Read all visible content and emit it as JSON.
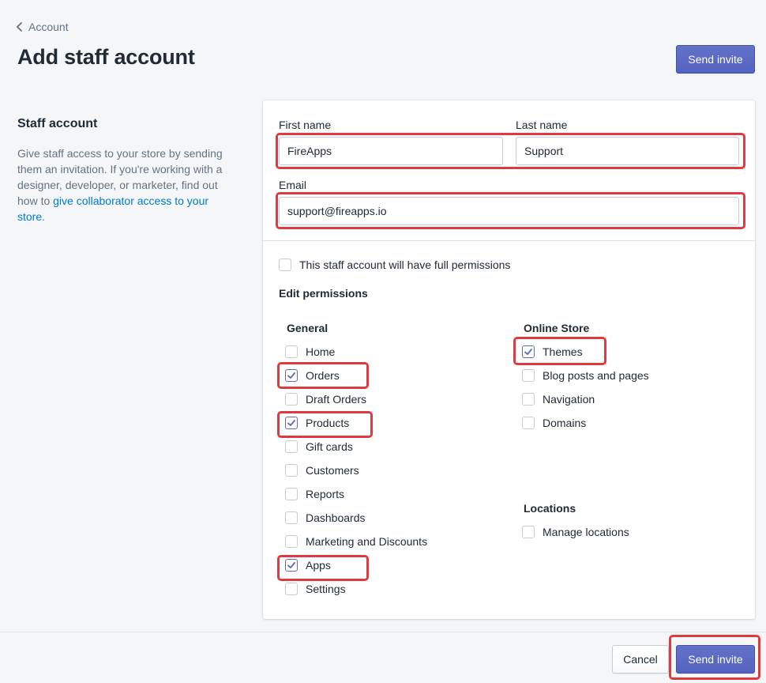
{
  "header": {
    "breadcrumb": "Account",
    "title": "Add staff account",
    "send_invite": "Send invite"
  },
  "section": {
    "heading": "Staff account",
    "description": "Give staff access to your store by sending them an invitation. If you're working with a designer, developer, or marketer, find out how to ",
    "link": "give collaborator access to your store",
    "tail": "."
  },
  "form": {
    "first_name_label": "First name",
    "first_name_value": "FireApps",
    "last_name_label": "Last name",
    "last_name_value": "Support",
    "email_label": "Email",
    "email_value": "support@fireapps.io"
  },
  "permissions": {
    "full_label": "This staff account will have full permissions",
    "full_checked": false,
    "edit_heading": "Edit permissions",
    "general_title": "General",
    "general": [
      {
        "label": "Home",
        "checked": false
      },
      {
        "label": "Orders",
        "checked": true
      },
      {
        "label": "Draft Orders",
        "checked": false
      },
      {
        "label": "Products",
        "checked": true
      },
      {
        "label": "Gift cards",
        "checked": false
      },
      {
        "label": "Customers",
        "checked": false
      },
      {
        "label": "Reports",
        "checked": false
      },
      {
        "label": "Dashboards",
        "checked": false
      },
      {
        "label": "Marketing and Discounts",
        "checked": false
      },
      {
        "label": "Apps",
        "checked": true
      },
      {
        "label": "Settings",
        "checked": false
      }
    ],
    "online_store_title": "Online Store",
    "online_store": [
      {
        "label": "Themes",
        "checked": true
      },
      {
        "label": "Blog posts and pages",
        "checked": false
      },
      {
        "label": "Navigation",
        "checked": false
      },
      {
        "label": "Domains",
        "checked": false
      }
    ],
    "locations_title": "Locations",
    "locations": [
      {
        "label": "Manage locations",
        "checked": false
      }
    ]
  },
  "footer": {
    "cancel": "Cancel",
    "send_invite": "Send invite"
  },
  "colors": {
    "primary": "#5c6ac4",
    "highlight": "#de3b40",
    "link": "#007ace"
  }
}
